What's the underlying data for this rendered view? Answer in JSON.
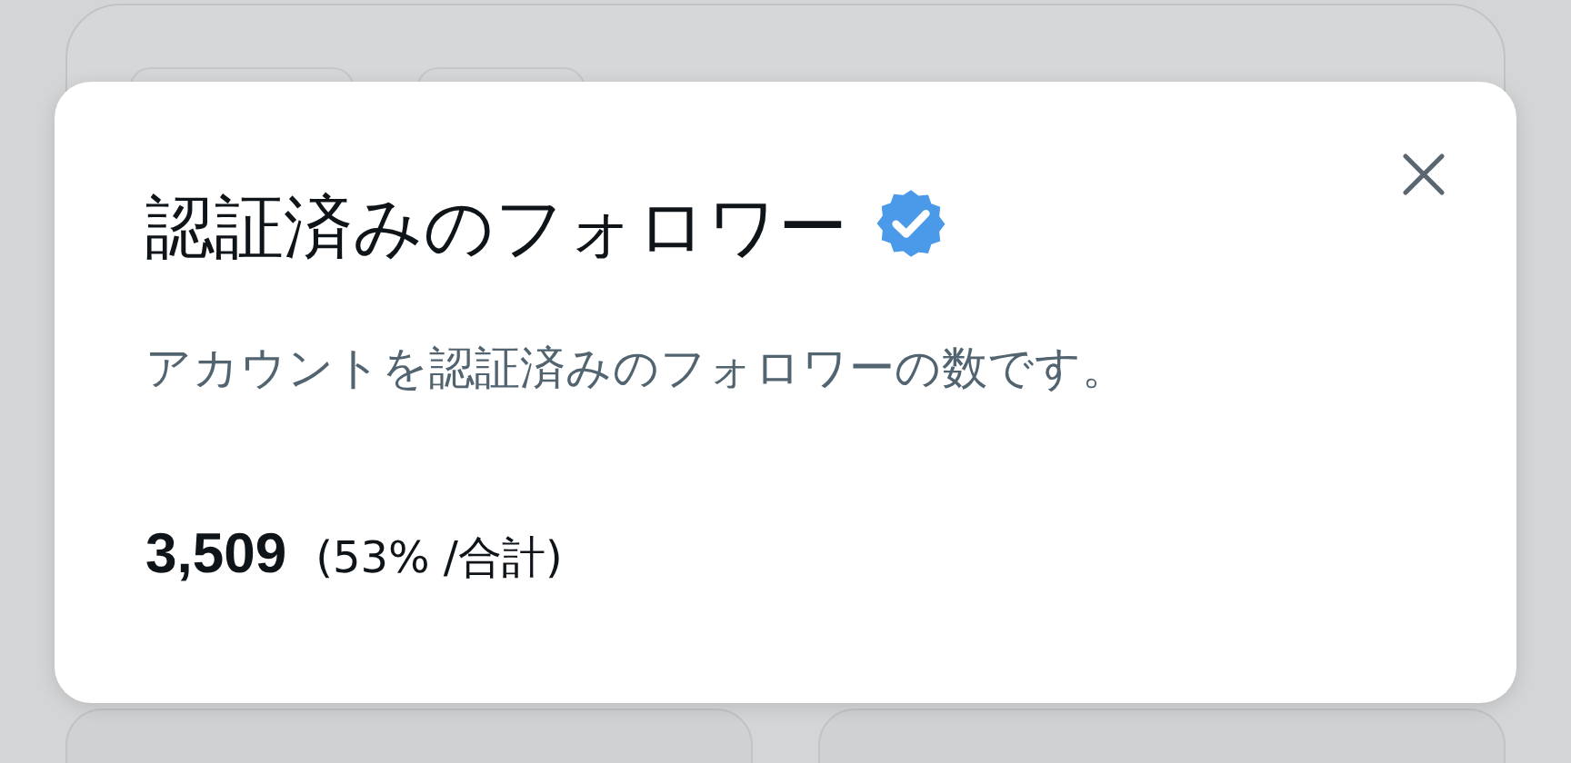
{
  "dialog": {
    "title": "認証済みのフォロワー",
    "verified": true,
    "description": "アカウントを認証済みのフォロワーの数です。",
    "count": "3,509",
    "share": "(53% /合計)"
  }
}
